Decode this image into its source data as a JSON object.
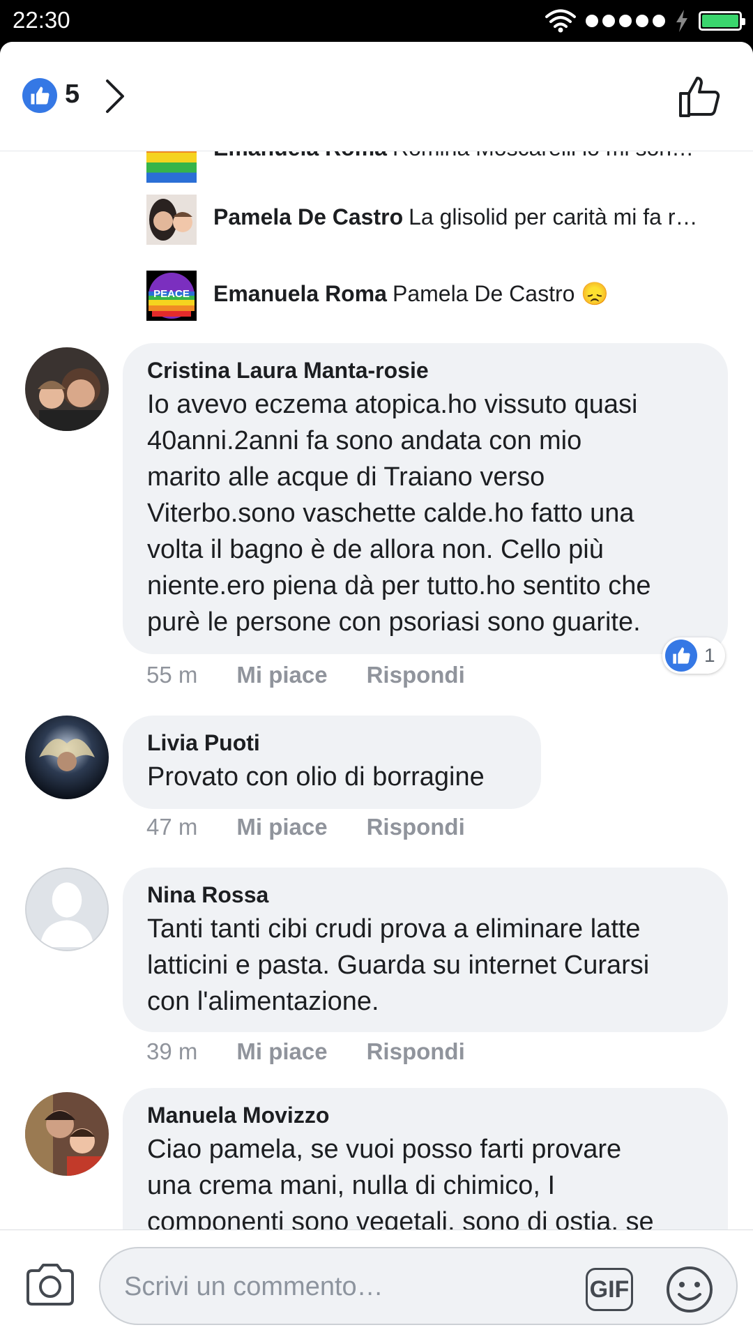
{
  "status_bar": {
    "time": "22:30"
  },
  "header": {
    "like_count": "5"
  },
  "replies": [
    {
      "name": "Emanuela Roma",
      "text": "Romina Moscarelli io mi son…"
    },
    {
      "name": "Pamela De Castro",
      "text": "La glisolid per carità mi fa r…"
    },
    {
      "name": "Emanuela Roma",
      "text": "Pamela De Castro 😞",
      "avatar_text": "PEACE"
    }
  ],
  "comments": [
    {
      "name": "Cristina Laura Manta-rosie",
      "lines": [
        "Io avevo eczema atopica.ho vissuto quasi",
        "40anni.2anni fa sono andata con mio",
        "marito alle acque di Traiano verso",
        "Viterbo.sono vaschette calde.ho fatto una",
        "volta il bagno è de allora non. Cello più",
        "niente.ero piena dà per tutto.ho sentito che",
        "purè le persone con psoriasi sono guarite."
      ],
      "time": "55 m",
      "like_label": "Mi piace",
      "reply_label": "Rispondi",
      "reaction_count": "1"
    },
    {
      "name": "Livia Puoti",
      "lines": [
        "Provato con olio di borragine"
      ],
      "time": "47 m",
      "like_label": "Mi piace",
      "reply_label": "Rispondi"
    },
    {
      "name": "Nina Rossa",
      "lines": [
        "Tanti tanti cibi crudi prova a eliminare latte",
        "latticini e pasta. Guarda su internet Curarsi",
        "con l'alimentazione."
      ],
      "time": "39 m",
      "like_label": "Mi piace",
      "reply_label": "Rispondi"
    },
    {
      "name": "Manuela Movizzo",
      "lines": [
        "Ciao pamela, se vuoi posso farti provare",
        "una crema mani, nulla di chimico, I",
        "componenti sono vegetali, sono di ostia, se"
      ]
    }
  ],
  "composer": {
    "placeholder": "Scrivi un commento…",
    "gif_label": "GIF"
  },
  "colors": {
    "accent": "#3578e5",
    "bubble": "#f0f2f5",
    "meta": "#90949c"
  },
  "icons": [
    "like-icon",
    "chevron-right-icon",
    "thumbs-up-outline-icon",
    "camera-icon",
    "gif-icon",
    "emoji-icon",
    "wifi-icon",
    "battery-icon"
  ]
}
